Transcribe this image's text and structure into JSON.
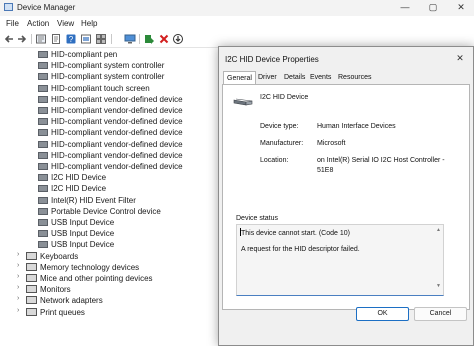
{
  "window": {
    "title": "Device Manager",
    "minimize": "—",
    "maximize": "▢",
    "close": "✕"
  },
  "menu": [
    "File",
    "Action",
    "View",
    "Help"
  ],
  "tree": {
    "hid_devices": [
      "HID-compliant pen",
      "HID-compliant system controller",
      "HID-compliant system controller",
      "HID-compliant touch screen",
      "HID-compliant vendor-defined device",
      "HID-compliant vendor-defined device",
      "HID-compliant vendor-defined device",
      "HID-compliant vendor-defined device",
      "HID-compliant vendor-defined device",
      "HID-compliant vendor-defined device",
      "HID-compliant vendor-defined device",
      "I2C HID Device",
      "I2C HID Device",
      "Intel(R) HID Event Filter",
      "Portable Device Control device",
      "USB Input Device",
      "USB Input Device",
      "USB Input Device"
    ],
    "categories": [
      "Keyboards",
      "Memory technology devices",
      "Mice and other pointing devices",
      "Monitors",
      "Network adapters",
      "Print queues"
    ]
  },
  "dialog": {
    "title": "I2C HID Device Properties",
    "close": "✕",
    "tabs": [
      "General",
      "Driver",
      "Details",
      "Events",
      "Resources"
    ],
    "device_name": "I2C HID Device",
    "device_type_label": "Device type:",
    "device_type": "Human Interface Devices",
    "manufacturer_label": "Manufacturer:",
    "manufacturer": "Microsoft",
    "location_label": "Location:",
    "location": "on Intel(R) Serial IO I2C Host Controller - 51E8",
    "status_group": "Device status",
    "status_line1": "This device cannot start. (Code 10)",
    "status_line2": "A request for the HID descriptor failed.",
    "ok": "OK",
    "cancel": "Cancel"
  }
}
